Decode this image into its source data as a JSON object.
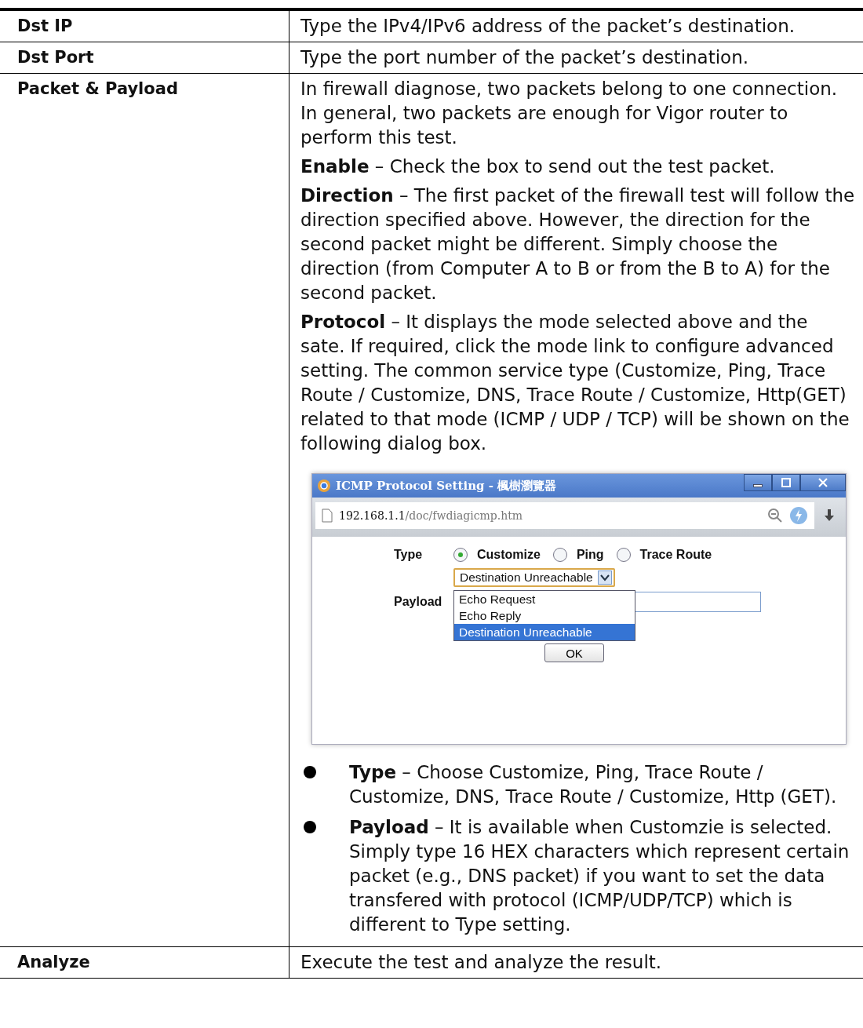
{
  "rows": [
    {
      "label": "Dst IP",
      "paragraphs": [
        "Type the IPv4/IPv6 address of the packet’s destination."
      ]
    },
    {
      "label": "Dst Port",
      "paragraphs": [
        "Type the port number of the packet’s destination."
      ]
    },
    {
      "label": "Packet & Payload",
      "paragraphs": [
        "In firewall diagnose, two packets belong to one connection. In general, two packets are enough for Vigor router to perform this test.",
        "**Enable** – Check the box to send out the test packet.",
        "**Direction** – The first packet of the firewall test will follow the direction specified above. However, the direction for the second packet might be different. Simply choose the direction (from Computer A to B or from the B to A) for the second packet.",
        "**Protocol** – It displays the mode selected above and the sate. If required, click the mode link to configure advanced setting. The common service type (Customize, Ping, Trace Route / Customize, DNS, Trace Route / Customize, Http(GET) related to that mode (ICMP / UDP / TCP) will be shown on the following dialog box."
      ],
      "dialog": {
        "title": "ICMP Protocol Setting - 楓樹瀏覽器",
        "url_host": "192.168.1.1",
        "url_path": "/doc/fwdiagicmp.htm",
        "type_label": "Type",
        "type_options": [
          {
            "label": "Customize",
            "selected": true
          },
          {
            "label": "Ping",
            "selected": false
          },
          {
            "label": "Trace Route",
            "selected": false
          }
        ],
        "select_value": "Destination Unreachable",
        "dropdown_options": [
          {
            "label": "Echo Request",
            "selected": false
          },
          {
            "label": "Echo Reply",
            "selected": false
          },
          {
            "label": "Destination Unreachable",
            "selected": true
          }
        ],
        "payload_label": "Payload",
        "ok_button": "OK"
      },
      "bullets": [
        "**Type** – Choose Customize, Ping, Trace Route / Customize, DNS, Trace Route / Customize, Http (GET).",
        "**Payload** – It is available when Customzie is selected. Simply type 16 HEX characters which represent certain packet (e.g., DNS packet) if you want to set the data transfered with protocol (ICMP/UDP/TCP) which is different to Type setting."
      ]
    },
    {
      "label": "Analyze",
      "paragraphs": [
        "Execute the test and analyze the result."
      ]
    }
  ]
}
